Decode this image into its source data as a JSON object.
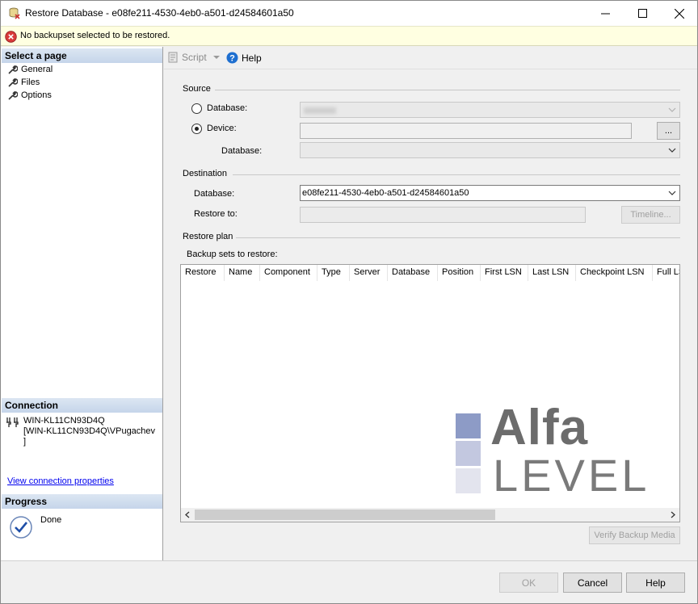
{
  "window": {
    "title": "Restore Database - e08fe211-4530-4eb0-a501-d24584601a50"
  },
  "message": {
    "text": "No backupset selected to be restored."
  },
  "left_pane": {
    "select_page_header": "Select a page",
    "pages": [
      {
        "label": "General"
      },
      {
        "label": "Files"
      },
      {
        "label": "Options"
      }
    ],
    "connection_header": "Connection",
    "connection_lines": [
      "WIN-KL11CN93D4Q",
      "[WIN-KL11CN93D4Q\\VPugachev",
      "]"
    ],
    "connection_link": "View connection properties",
    "progress_header": "Progress",
    "progress_status": "Done"
  },
  "toolbar": {
    "script_label": "Script",
    "help_label": "Help"
  },
  "source": {
    "group_label": "Source",
    "database_radio_label": "Database:",
    "device_radio_label": "Device:",
    "device_database_label": "Database:",
    "browse_label": "..."
  },
  "destination": {
    "group_label": "Destination",
    "database_label": "Database:",
    "database_value": "e08fe211-4530-4eb0-a501-d24584601a50",
    "restore_to_label": "Restore to:",
    "timeline_label": "Timeline..."
  },
  "restore_plan": {
    "group_label": "Restore plan",
    "backup_sets_label": "Backup sets to restore:",
    "columns": [
      "Restore",
      "Name",
      "Component",
      "Type",
      "Server",
      "Database",
      "Position",
      "First LSN",
      "Last LSN",
      "Checkpoint LSN",
      "Full LS"
    ],
    "verify_label": "Verify Backup Media"
  },
  "watermark": {
    "word1": "Alfa",
    "word2": "LEVEL",
    "colors": [
      "#8d9bc6",
      "#c3c8e0",
      "#e3e4ee"
    ]
  },
  "footer": {
    "ok_label": "OK",
    "cancel_label": "Cancel",
    "help_label": "Help"
  }
}
